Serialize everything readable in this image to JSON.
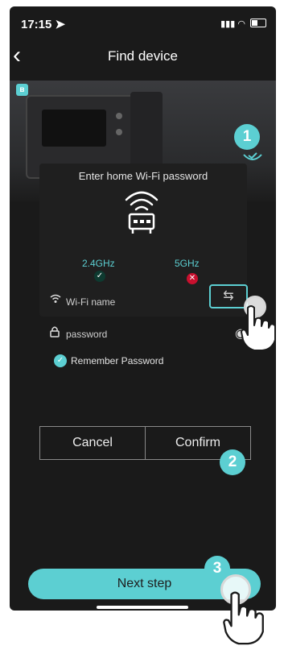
{
  "status_bar": {
    "time": "17:15 ➤",
    "signal": "▮▮▮",
    "wifi": "◠"
  },
  "nav": {
    "back": "‹",
    "title": "Find device"
  },
  "icons": {
    "bluetooth": "bluetooth-icon",
    "wifi": "wifi-icon",
    "lock": "lock-icon",
    "eye": "eye-icon",
    "swap": "swap-icon",
    "router": "router-icon"
  },
  "dialog": {
    "title": "Enter home Wi-Fi password",
    "bands": [
      {
        "label": "2.4GHz",
        "mark": "✓"
      },
      {
        "label": "5GHz",
        "mark": "✕"
      }
    ],
    "wifi_name": {
      "placeholder": "Wi-Fi name"
    },
    "password": {
      "placeholder": "password"
    },
    "remember": {
      "label": "Remember Password",
      "checked": true
    },
    "swap_glyph": "⇆",
    "eye_glyph": "◉",
    "cancel_label": "Cancel",
    "confirm_label": "Confirm"
  },
  "steps": {
    "one": "1",
    "two": "2",
    "three": "3"
  },
  "next_step_label": "Next step",
  "colors": {
    "accent": "#5ccfd2",
    "background": "#1a1a1a",
    "error": "#c8102e"
  }
}
